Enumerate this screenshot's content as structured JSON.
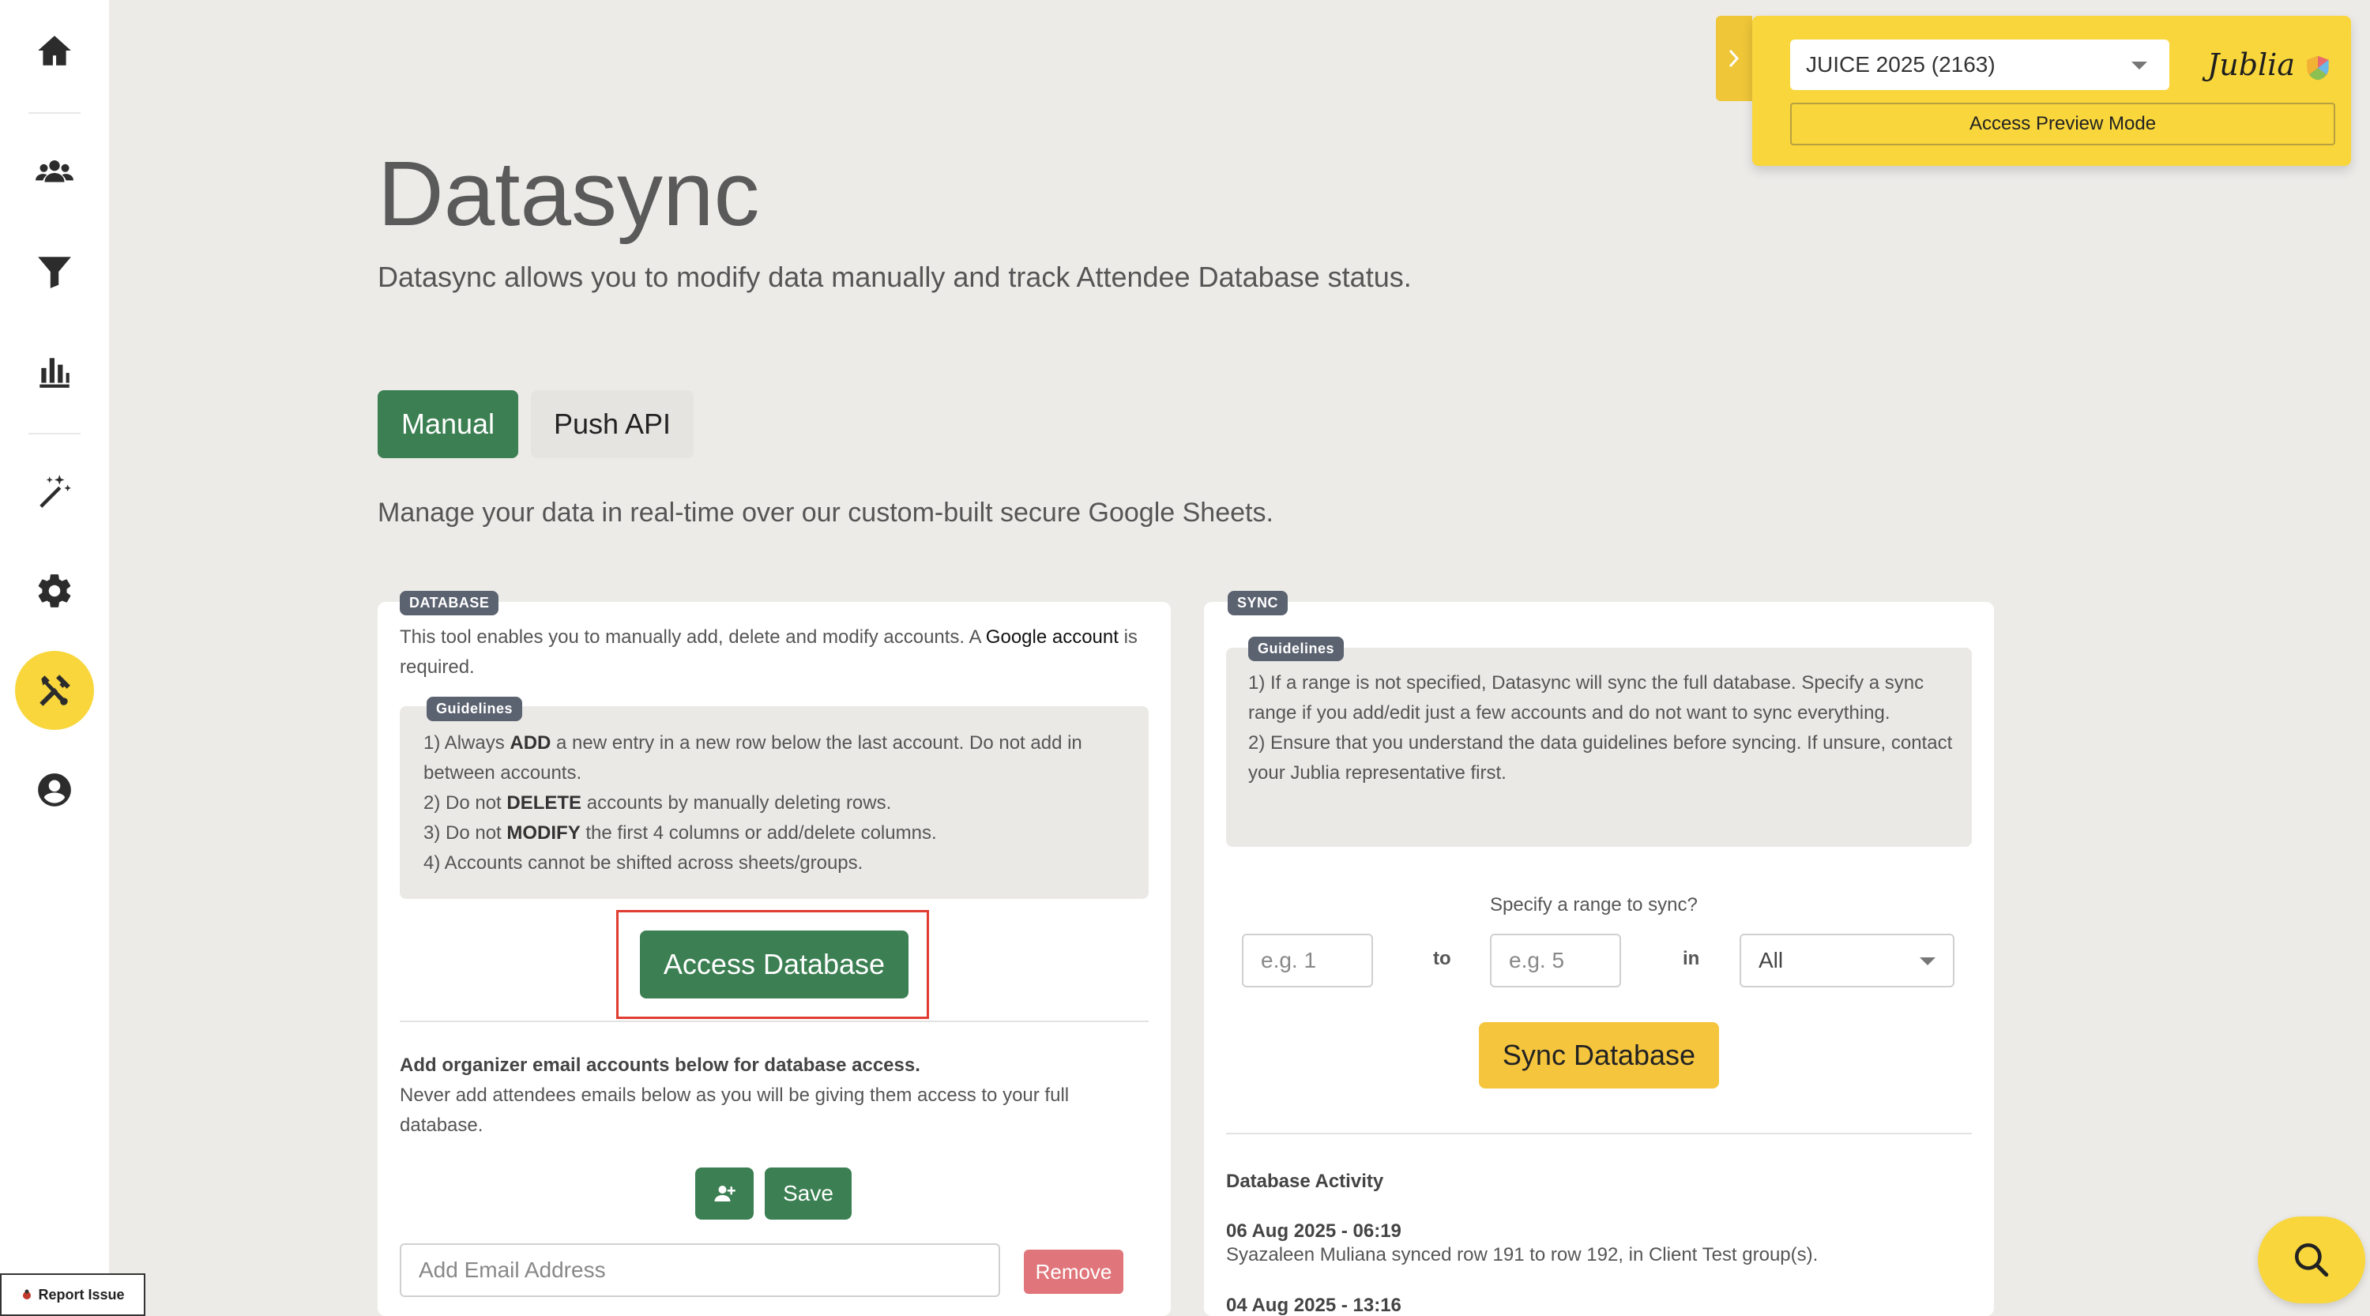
{
  "sidebar": {
    "items": [
      {
        "name": "home-icon"
      },
      {
        "name": "people-icon"
      },
      {
        "name": "funnel-icon"
      },
      {
        "name": "bar-chart-icon"
      },
      {
        "name": "magic-wand-icon"
      },
      {
        "name": "gear-icon"
      },
      {
        "name": "tools-icon",
        "active": true
      },
      {
        "name": "account-circle-icon"
      }
    ]
  },
  "event_panel": {
    "selected_event": "JUICE 2025 (2163)",
    "brand": "Jublia",
    "preview_button": "Access Preview Mode"
  },
  "header": {
    "title": "Datasync",
    "subtitle": "Datasync allows you to modify data manually and track Attendee Database status."
  },
  "tabs": [
    {
      "label": "Manual",
      "active": true
    },
    {
      "label": "Push API",
      "active": false
    }
  ],
  "tab_description": "Manage your data in real-time over our custom-built secure Google Sheets.",
  "database": {
    "badge": "DATABASE",
    "intro_part1": "This tool enables you to manually add, delete and modify accounts. A ",
    "intro_link": "Google account",
    "intro_part2": " is required.",
    "guidelines_badge": "Guidelines",
    "guidelines": [
      {
        "pre": "1) Always ",
        "bold": "ADD",
        "post": " a new entry in a new row below the last account. Do not add in between accounts."
      },
      {
        "pre": "2) Do not ",
        "bold": "DELETE",
        "post": " accounts by manually deleting rows."
      },
      {
        "pre": "3) Do not ",
        "bold": "MODIFY",
        "post": " the first 4 columns or add/delete columns."
      },
      {
        "pre": "4) Accounts cannot be shifted across sheets/groups.",
        "bold": "",
        "post": ""
      }
    ],
    "access_button": "Access Database",
    "organizer_heading": "Add organizer email accounts below for database access.",
    "organizer_warning": "Never add attendees emails below as you will be giving them access to your full database.",
    "save_button": "Save",
    "email_placeholder": "Add Email Address",
    "remove_button": "Remove"
  },
  "sync": {
    "badge": "SYNC",
    "guidelines_badge": "Guidelines",
    "guidelines": [
      "1) If a range is not specified, Datasync will sync the full database. Specify a sync range if you add/edit just a few accounts and do not want to sync everything.",
      "2) Ensure that you understand the data guidelines before syncing. If unsure, contact your Jublia representative first."
    ],
    "range_label": "Specify a range to sync?",
    "from_placeholder": "e.g. 1",
    "to_label": "to",
    "to_placeholder": "e.g. 5",
    "in_label": "in",
    "group_selected": "All",
    "sync_button": "Sync Database",
    "activity_title": "Database Activity",
    "activity": [
      {
        "timestamp": "06 Aug 2025 - 06:19",
        "text": "Syazaleen Muliana synced row 191 to row 192, in Client Test group(s)."
      },
      {
        "timestamp": "04 Aug 2025 - 13:16",
        "text": ""
      }
    ]
  },
  "report_issue": "Report Issue",
  "colors": {
    "primary_green": "#3b7f52",
    "accent_yellow": "#f8d63c",
    "sync_yellow": "#f5c53e",
    "remove_red": "#e0767b",
    "highlight_red": "#e03c31"
  }
}
